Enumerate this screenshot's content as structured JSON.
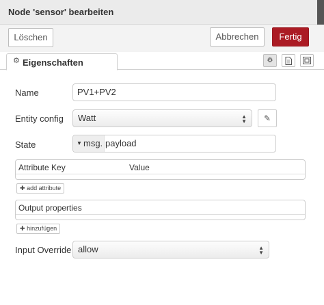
{
  "dialog": {
    "title": "Node 'sensor' bearbeiten"
  },
  "toolbar": {
    "delete_label": "Löschen",
    "cancel_label": "Abbrechen",
    "done_label": "Fertig"
  },
  "tabs": {
    "properties_label": "Eigenschaften"
  },
  "form": {
    "name_label": "Name",
    "name_value": "PV1+PV2",
    "entity_config_label": "Entity config",
    "entity_config_value": "Watt",
    "state_label": "State",
    "state_type": "msg.",
    "state_value": "payload",
    "attributes": {
      "col_key": "Attribute Key",
      "col_value": "Value",
      "add_label": "add attribute"
    },
    "output_properties": {
      "header": "Output properties",
      "add_label": "hinzufügen"
    },
    "input_override_label": "Input Override",
    "input_override_value": "allow"
  },
  "colors": {
    "primary_button": "#ab1b24"
  },
  "icons": [
    "gear-icon",
    "document-icon",
    "layout-icon",
    "pencil-icon",
    "plus-icon",
    "caret-down-icon",
    "select-arrows-icon"
  ]
}
